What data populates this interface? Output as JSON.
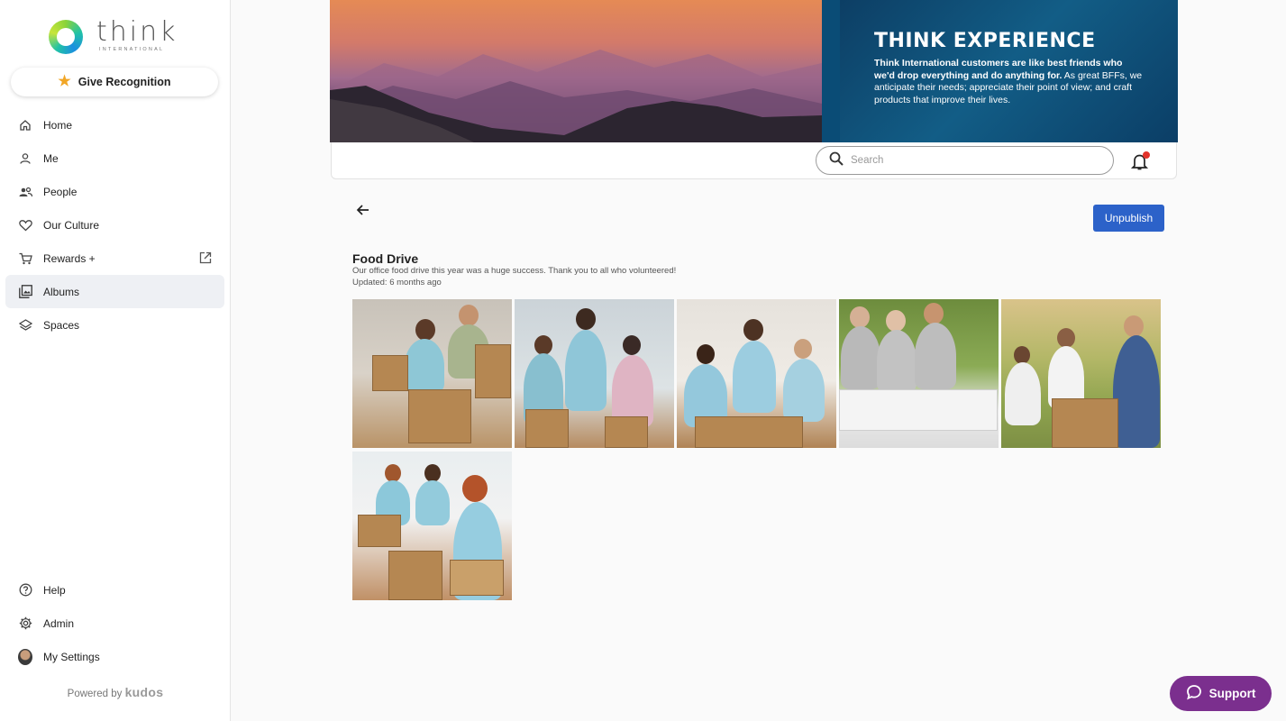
{
  "brand": {
    "logo_word": "think",
    "logo_sub": "INTERNATIONAL"
  },
  "give_recognition": {
    "label": "Give Recognition"
  },
  "nav": {
    "items": [
      {
        "label": "Home",
        "icon": "home-icon"
      },
      {
        "label": "Me",
        "icon": "person-icon"
      },
      {
        "label": "People",
        "icon": "people-icon"
      },
      {
        "label": "Our Culture",
        "icon": "heart-icon"
      },
      {
        "label": "Rewards +",
        "icon": "cart-icon"
      },
      {
        "label": "Albums",
        "icon": "album-icon",
        "active": true
      },
      {
        "label": "Spaces",
        "icon": "layers-icon"
      }
    ],
    "bottom": [
      {
        "label": "Help",
        "icon": "help-icon"
      },
      {
        "label": "Admin",
        "icon": "gear-icon"
      },
      {
        "label": "My Settings",
        "icon": "avatar"
      }
    ]
  },
  "powered": {
    "prefix": "Powered by",
    "brand": "kudos"
  },
  "banner": {
    "title": "THINK EXPERIENCE",
    "bold_text": "Think International customers are like best friends who we'd drop everything and do anything for.",
    "text": " As great BFFs, we anticipate their needs; appreciate their point of view; and craft products that improve their lives."
  },
  "search": {
    "placeholder": "Search"
  },
  "album": {
    "title": "Food Drive",
    "description": "Our office food drive this year was a huge success. Thank you to all who volunteered!",
    "updated": "Updated: 6 months ago",
    "unpublish_label": "Unpublish",
    "photo_count": 6
  },
  "support": {
    "label": "Support"
  },
  "colors": {
    "accent": "#2c62c9",
    "support": "#7b2f8e",
    "active_nav": "#eef0f4"
  }
}
